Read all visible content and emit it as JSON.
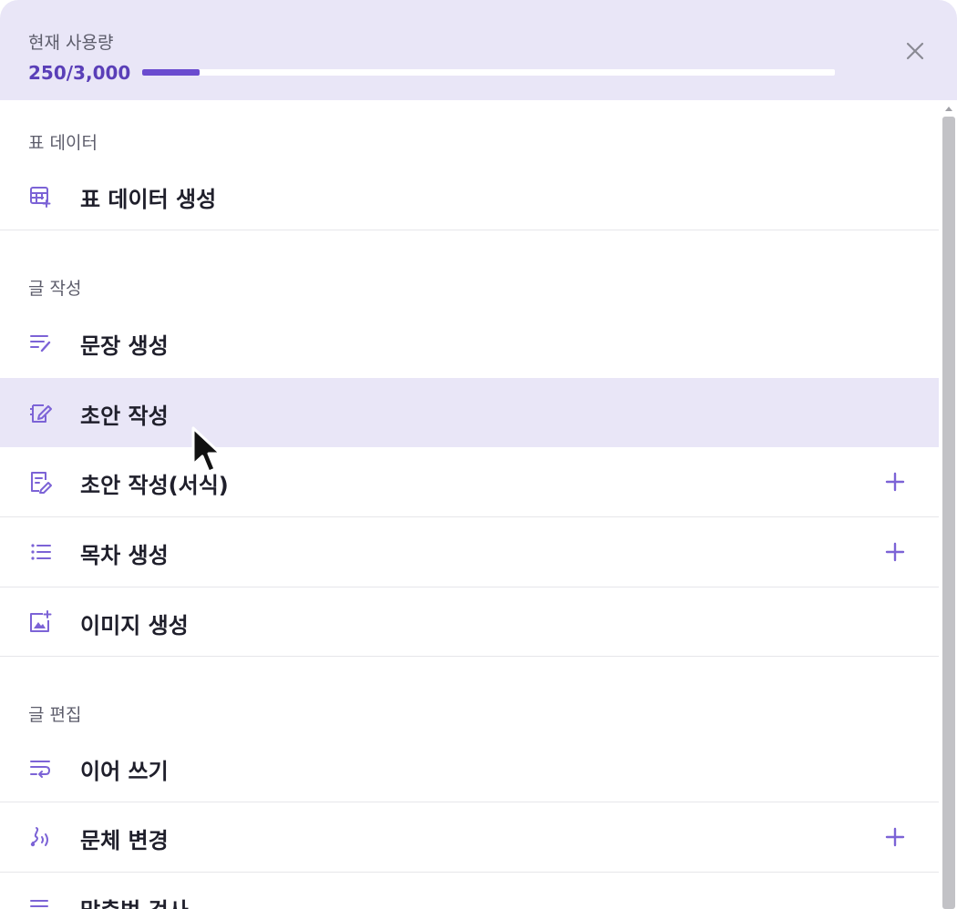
{
  "header": {
    "usage_label": "현재 사용량",
    "usage_value": "250/3,000",
    "usage_fraction": 0.0833
  },
  "sections": [
    {
      "label": "표 데이터"
    },
    {
      "label": "글 작성"
    },
    {
      "label": "글 편집"
    }
  ],
  "items": [
    {
      "label": "표 데이터 생성",
      "icon": "table-add-icon"
    },
    {
      "label": "문장 생성",
      "icon": "lines-pen-icon"
    },
    {
      "label": "초안 작성",
      "icon": "draft-pen-icon",
      "state": "hovered"
    },
    {
      "label": "초안 작성(서식)",
      "icon": "document-pen-icon",
      "has_add": true
    },
    {
      "label": "목차 생성",
      "icon": "list-icon",
      "has_add": true
    },
    {
      "label": "이미지 생성",
      "icon": "image-add-icon"
    },
    {
      "label": "이어 쓰기",
      "icon": "wrap-text-icon"
    },
    {
      "label": "문체 변경",
      "icon": "style-wave-icon",
      "has_add": true
    },
    {
      "label": "맞춤법 검사",
      "icon": "lines-icon"
    }
  ],
  "colors": {
    "accent": "#6a4bcf",
    "header_bg": "#e9e6f7",
    "icon": "#7c63d6",
    "text": "#1f1f2b"
  }
}
